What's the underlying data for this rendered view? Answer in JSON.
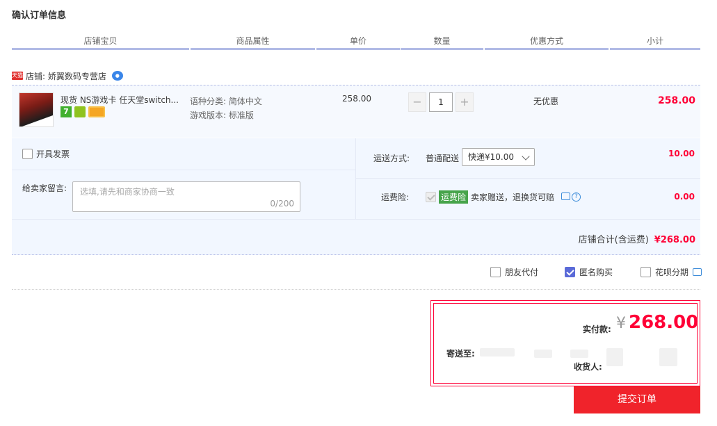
{
  "page_title": "确认订单信息",
  "table_headers": [
    "店铺宝贝",
    "商品属性",
    "单价",
    "数量",
    "优惠方式",
    "小计"
  ],
  "shop": {
    "badge": "天猫",
    "label": "店铺: 娇翼数码专营店"
  },
  "item": {
    "name": "现货 NS游戏卡 任天堂switch...",
    "attr_language": "语种分类: 简体中文",
    "attr_version": "游戏版本: 标准版",
    "price": "258.00",
    "quantity": "1",
    "minus": "−",
    "plus": "+",
    "discount": "无优惠",
    "subtotal": "258.00",
    "icon_7": "7"
  },
  "invoice": {
    "label": "开具发票",
    "checked": false
  },
  "message": {
    "label": "给卖家留言:",
    "placeholder": "选填,请先和商家协商一致",
    "count": "0/200"
  },
  "shipping": {
    "label": "运送方式:",
    "type": "普通配送",
    "selected": "快递¥10.00",
    "fee": "10.00"
  },
  "insurance": {
    "label": "运费险:",
    "badge": "运费险",
    "desc": "卖家赠送，退换货可赔",
    "fee": "0.00"
  },
  "shop_total": {
    "label": "店铺合计(含运费)",
    "amount": "¥268.00"
  },
  "options": {
    "friend_pay": "朋友代付",
    "anonymous": "匿名购买",
    "huabei": "花呗分期"
  },
  "payment": {
    "label": "实付款:",
    "currency": "¥",
    "amount": "268.00",
    "ship_to": "寄送至:",
    "receiver": "收货人:"
  },
  "submit_label": "提交订单",
  "colors": {
    "accent": "#ff0036",
    "submit": "#f0232b",
    "header_line": "#b2bbe6"
  }
}
